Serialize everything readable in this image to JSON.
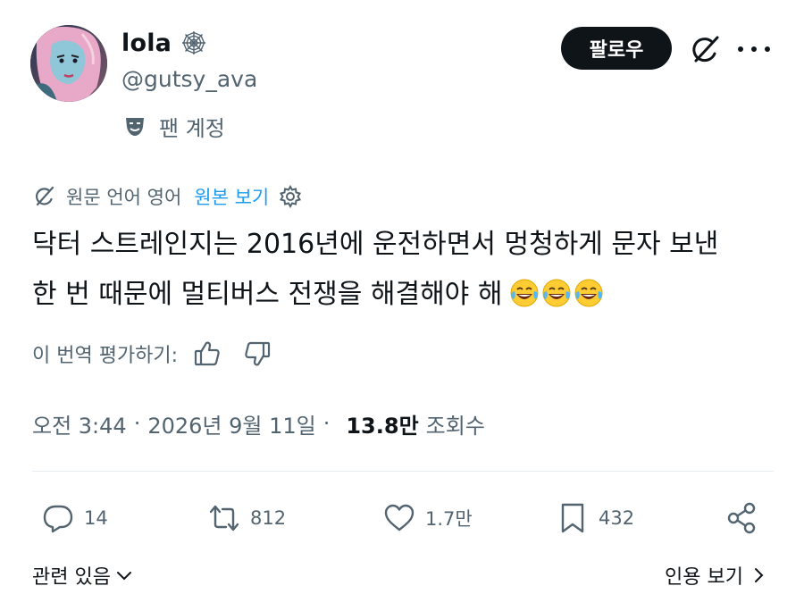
{
  "profile": {
    "display_name": "lola",
    "handle": "@gutsy_ava",
    "fan_label": "팬 계정",
    "badge_icon": "spiderweb-icon",
    "fan_icon": "theater-mask-icon"
  },
  "header": {
    "follow_label": "팔로우",
    "grok_icon": "grok-icon",
    "more_icon": "more-icon"
  },
  "translation": {
    "source_text": "원문 언어 영어",
    "show_original_label": "원본 보기",
    "settings_icon": "gear-icon"
  },
  "tweet": {
    "line1": "닥터 스트레인지는 2016년에 운전하면서 멍청하게 문자 보낸",
    "line2": "한 번 때문에 멀티버스 전쟁을 해결해야 해",
    "emoji_count": 3,
    "emoji_name": "face-with-tears-of-joy"
  },
  "rating": {
    "label": "이 번역 평가하기:",
    "up_icon": "thumbs-up-icon",
    "down_icon": "thumbs-down-icon"
  },
  "meta": {
    "time": "오전 3:44",
    "date": "2026년 9월 11일",
    "views_count": "13.8만",
    "views_label": "조회수",
    "separator": "·"
  },
  "actions": {
    "replies": "14",
    "retweets": "812",
    "likes": "1.7만",
    "bookmarks": "432"
  },
  "footer": {
    "related_label": "관련 있음",
    "quotes_label": "인용 보기"
  },
  "colors": {
    "text_primary": "#0f1419",
    "text_secondary": "#536471",
    "link_blue": "#1d9bf0",
    "follow_bg": "#0f1419"
  }
}
